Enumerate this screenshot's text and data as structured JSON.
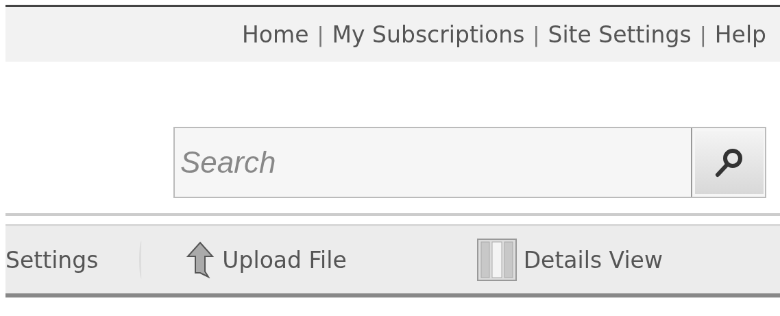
{
  "top_nav": {
    "separator": "|",
    "links": [
      "Home",
      "My Subscriptions",
      "Site Settings",
      "Help"
    ]
  },
  "search": {
    "placeholder": "Search"
  },
  "toolbar": [
    {
      "kind": "text",
      "label": "Settings"
    },
    {
      "kind": "divider"
    },
    {
      "kind": "upload",
      "label": "Upload File"
    },
    {
      "kind": "details",
      "label": "Details View"
    }
  ]
}
